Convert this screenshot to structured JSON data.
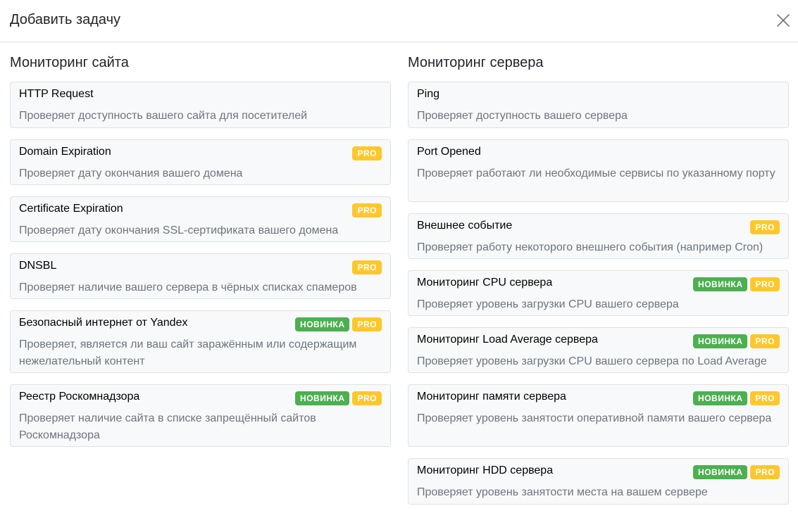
{
  "modal": {
    "title": "Добавить задачу",
    "close_icon": "close-icon"
  },
  "badges": {
    "new": "НОВИНКА",
    "pro": "PRO"
  },
  "colors": {
    "badge_new": "#4caf50",
    "badge_pro": "#ffc72c",
    "card_bg": "#f8f9fa",
    "desc_text": "#6c757d"
  },
  "site_monitoring": {
    "title": "Мониторинг сайта",
    "items": [
      {
        "title": "HTTP Request",
        "description": "Проверяет доступность вашего сайта для посетителей",
        "new": false,
        "pro": false
      },
      {
        "title": "Domain Expiration",
        "description": "Проверяет дату окончания вашего домена",
        "new": false,
        "pro": true
      },
      {
        "title": "Certificate Expiration",
        "description": "Проверяет дату окончания SSL-сертификата вашего домена",
        "new": false,
        "pro": true
      },
      {
        "title": "DNSBL",
        "description": "Проверяет наличие вашего сервера в чёрных списках спамеров",
        "new": false,
        "pro": true
      },
      {
        "title": "Безопасный интернет от Yandex",
        "description": "Проверяет, является ли ваш сайт заражённым или содержащим нежелательный контент",
        "new": true,
        "pro": true
      },
      {
        "title": "Реестр Роскомнадзора",
        "description": "Проверяет наличие сайта в списке запрещённый сайтов Роскомнадзора",
        "new": true,
        "pro": true
      }
    ]
  },
  "server_monitoring": {
    "title": "Мониторинг сервера",
    "items": [
      {
        "title": "Ping",
        "description": "Проверяет доступность вашего сервера",
        "new": false,
        "pro": false
      },
      {
        "title": "Port Opened",
        "description": "Проверяет работают ли необходимые сервисы по указанному порту",
        "new": false,
        "pro": false
      },
      {
        "title": "Внешнее событие",
        "description": "Проверяет работу некоторого внешнего события (например Cron)",
        "new": false,
        "pro": true
      },
      {
        "title": "Мониторинг CPU сервера",
        "description": "Проверяет уровень загрузки CPU вашего сервера",
        "new": true,
        "pro": true
      },
      {
        "title": "Мониторинг Load Average сервера",
        "description": "Проверяет уровень загрузки CPU вашего сервера по Load Average",
        "new": true,
        "pro": true
      },
      {
        "title": "Мониторинг памяти сервера",
        "description": "Проверяет уровень занятости оперативной памяти вашего сервера",
        "new": true,
        "pro": true
      },
      {
        "title": "Мониторинг HDD сервера",
        "description": "Проверяет уровень занятости места на вашем сервере",
        "new": true,
        "pro": true
      }
    ]
  }
}
